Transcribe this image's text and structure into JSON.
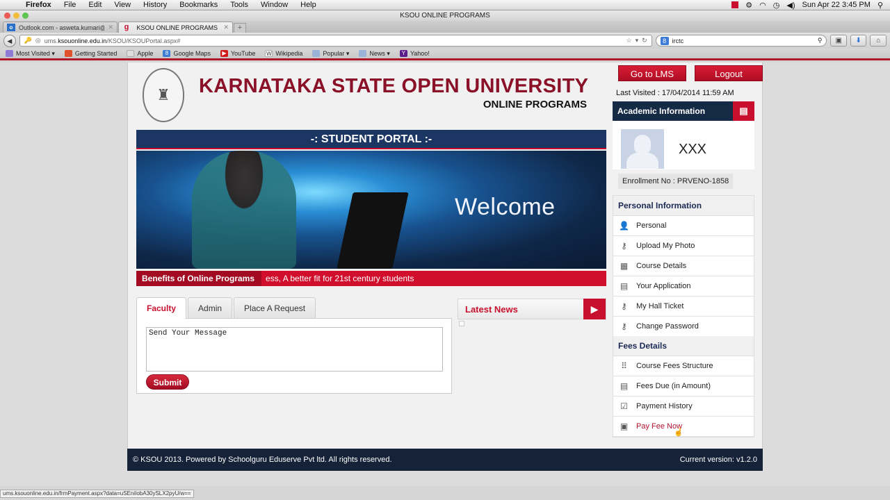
{
  "os_menubar": {
    "items": [
      "Firefox",
      "File",
      "Edit",
      "View",
      "History",
      "Bookmarks",
      "Tools",
      "Window",
      "Help"
    ],
    "clock": "Sun Apr 22  3:45 PM"
  },
  "window": {
    "title": "KSOU ONLINE PROGRAMS"
  },
  "tabs": [
    {
      "label": "Outlook.com - asweta.kumari@...",
      "icon": "outlook-icon",
      "active": false
    },
    {
      "label": "KSOU ONLINE PROGRAMS",
      "icon": "g-icon",
      "active": true
    }
  ],
  "navbar": {
    "url_prefix": "ums.",
    "url_domain": "ksouonline.edu.in",
    "url_path": "/KSOU/KSOUPortal.aspx#",
    "search_value": "irctc"
  },
  "bookmarks": [
    {
      "label": "Most Visited ▾",
      "color": "#8d7bd6"
    },
    {
      "label": "Getting Started",
      "color": "#e0522b"
    },
    {
      "label": "Apple",
      "color": "#bbbbbb"
    },
    {
      "label": "Google Maps",
      "color": "#3c7bd6"
    },
    {
      "label": "YouTube",
      "color": "#d11a1a"
    },
    {
      "label": "Wikipedia",
      "color": "#666666"
    },
    {
      "label": "Popular ▾",
      "color": "#9ab3d6"
    },
    {
      "label": "News ▾",
      "color": "#9ab3d6"
    },
    {
      "label": "Yahoo!",
      "color": "#5b1e8c"
    }
  ],
  "header": {
    "title": "KARNATAKA STATE OPEN UNIVERSITY",
    "subtitle": "ONLINE PROGRAMS",
    "portal": "-: STUDENT PORTAL :-"
  },
  "banner": {
    "welcome": "Welcome"
  },
  "ticker": {
    "label": "Benefits of Online Programs",
    "text": "ess, A better fit for 21st century students"
  },
  "contact": {
    "tabs": [
      "Faculty",
      "Admin",
      "Place A Request"
    ],
    "active_tab": "Faculty",
    "message": "Send Your Message",
    "submit": "Submit"
  },
  "news": {
    "title": "Latest News"
  },
  "sidebar": {
    "lms_button": "Go to LMS",
    "logout_button": "Logout",
    "last_visited": "Last Visited : 17/04/2014 11:59 AM",
    "academic_title": "Academic Information",
    "student_name": "XXX",
    "enrollment": "Enrollment No : PRVENO-1858",
    "personal": {
      "header": "Personal Information",
      "items": [
        {
          "label": "Personal",
          "icon": "person-icon"
        },
        {
          "label": "Upload My Photo",
          "icon": "key-icon"
        },
        {
          "label": "Course Details",
          "icon": "folder-icon"
        },
        {
          "label": "Your Application",
          "icon": "calendar-icon"
        },
        {
          "label": "My Hall Ticket",
          "icon": "key-icon"
        },
        {
          "label": "Change Password",
          "icon": "key-icon"
        }
      ]
    },
    "fees": {
      "header": "Fees Details",
      "items": [
        {
          "label": "Course Fees Structure",
          "icon": "grid-icon"
        },
        {
          "label": "Fees Due (in Amount)",
          "icon": "calendar-icon"
        },
        {
          "label": "Payment History",
          "icon": "checkbox-icon"
        },
        {
          "label": "Pay Fee Now",
          "icon": "clipboard-icon"
        }
      ]
    }
  },
  "footer": {
    "copyright": "© KSOU 2013. Powered by Schoolguru Eduserve Pvt ltd. All rights reserved.",
    "version": "Current version: v1.2.0"
  },
  "statusbar": {
    "url": "ums.ksouonline.edu.in/frmPayment.aspx?data=uSEniIobA30ySLX2pyU/w=="
  },
  "colors": {
    "brand_red": "#c8102e",
    "navy": "#152a45",
    "title_red": "#8a1127"
  }
}
